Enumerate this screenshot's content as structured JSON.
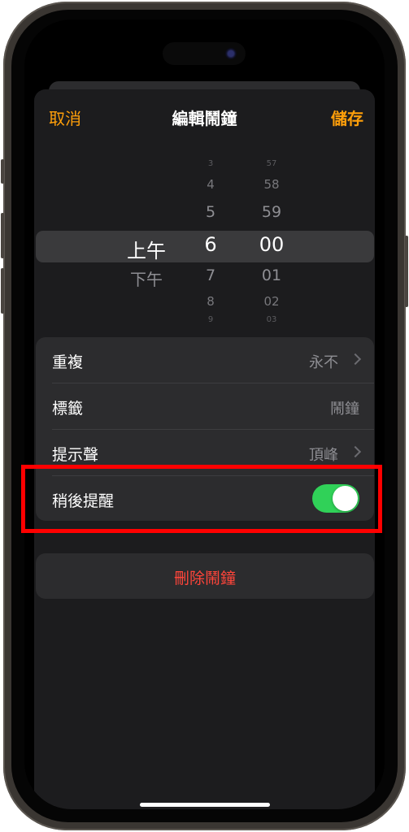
{
  "nav": {
    "cancel_label": "取消",
    "title": "編輯鬧鐘",
    "save_label": "儲存"
  },
  "picker": {
    "ampm": {
      "above": "",
      "selected": "上午",
      "below": "下午"
    },
    "hours": {
      "above": [
        "3",
        "4",
        "5"
      ],
      "selected": "6",
      "below": [
        "7",
        "8",
        "9"
      ]
    },
    "minutes": {
      "above": [
        "57",
        "58",
        "59"
      ],
      "selected": "00",
      "below": [
        "01",
        "02",
        "03"
      ]
    }
  },
  "settings": {
    "repeat": {
      "label": "重複",
      "value": "永不"
    },
    "label": {
      "label": "標籤",
      "placeholder": "鬧鐘"
    },
    "sound": {
      "label": "提示聲",
      "value": "頂峰"
    },
    "snooze": {
      "label": "稍後提醒",
      "on": true
    }
  },
  "delete_button": {
    "label": "刪除鬧鐘"
  },
  "colors": {
    "accent": "#ff9f0a",
    "toggle_on": "#30d158",
    "destructive": "#ff453a",
    "annotation": "#ff0000"
  }
}
